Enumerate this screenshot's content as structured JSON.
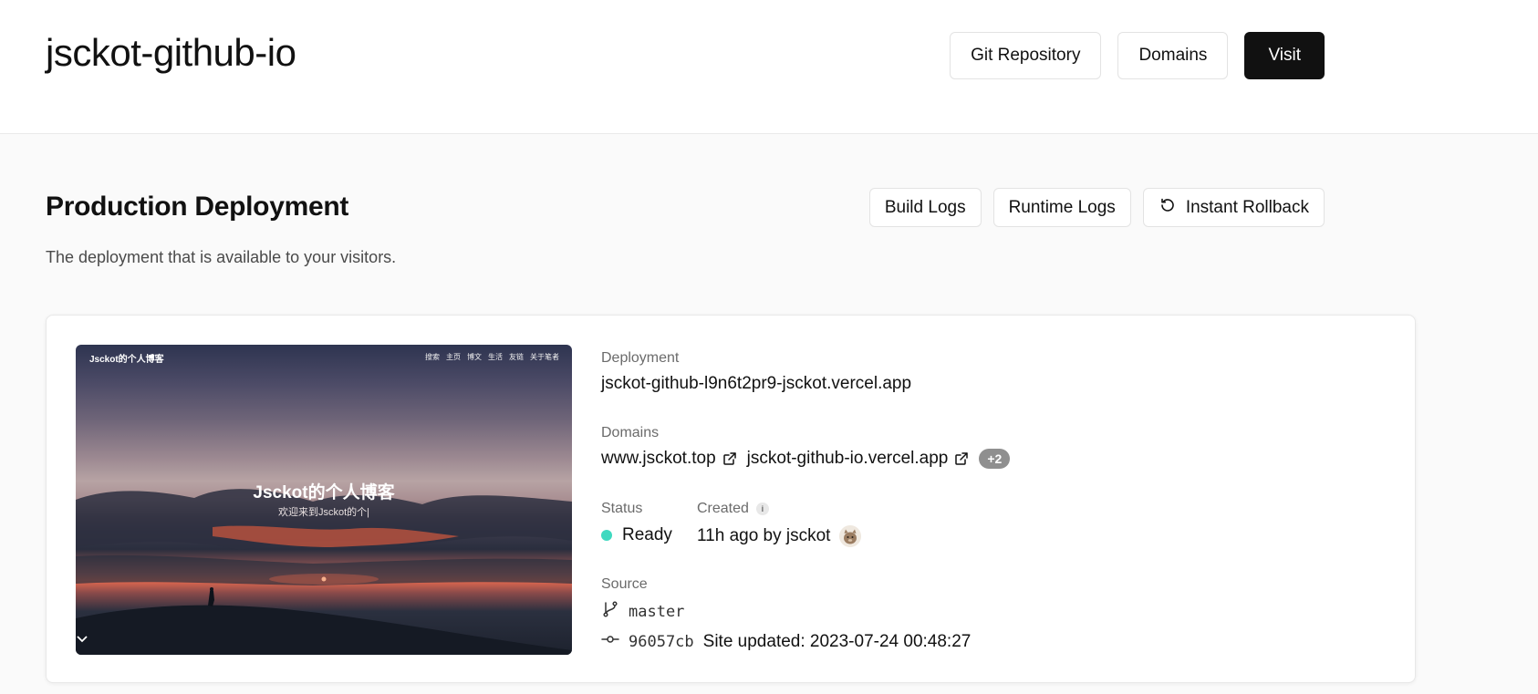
{
  "header": {
    "title": "jsckot-github-io",
    "actions": {
      "git_repository": "Git Repository",
      "domains": "Domains",
      "visit": "Visit"
    }
  },
  "section": {
    "title": "Production Deployment",
    "description": "The deployment that is available to your visitors.",
    "actions": {
      "build_logs": "Build Logs",
      "runtime_logs": "Runtime Logs",
      "instant_rollback": "Instant Rollback"
    }
  },
  "preview": {
    "site_logo": "Jsckot的个人博客",
    "nav": [
      "搜索",
      "主页",
      "博文",
      "生活",
      "友链",
      "关于笔者"
    ],
    "hero_title": "Jsckot的个人博客",
    "hero_subtitle": "欢迎来到Jsckot的个|"
  },
  "deployment": {
    "label": "Deployment",
    "url": "jsckot-github-l9n6t2pr9-jsckot.vercel.app"
  },
  "domains": {
    "label": "Domains",
    "items": [
      "www.jsckot.top",
      "jsckot-github-io.vercel.app"
    ],
    "more_badge": "+2"
  },
  "status": {
    "label": "Status",
    "value": "Ready",
    "color": "#3fd9c0"
  },
  "created": {
    "label": "Created",
    "info_icon": "i",
    "value": "11h ago by jsckot"
  },
  "source": {
    "label": "Source",
    "branch": "master",
    "commit_hash": "96057cb",
    "commit_message": "Site updated: 2023-07-24 00:48:27"
  },
  "colors": {
    "primary_button": "#111111",
    "badge": "#8f8f8f"
  }
}
